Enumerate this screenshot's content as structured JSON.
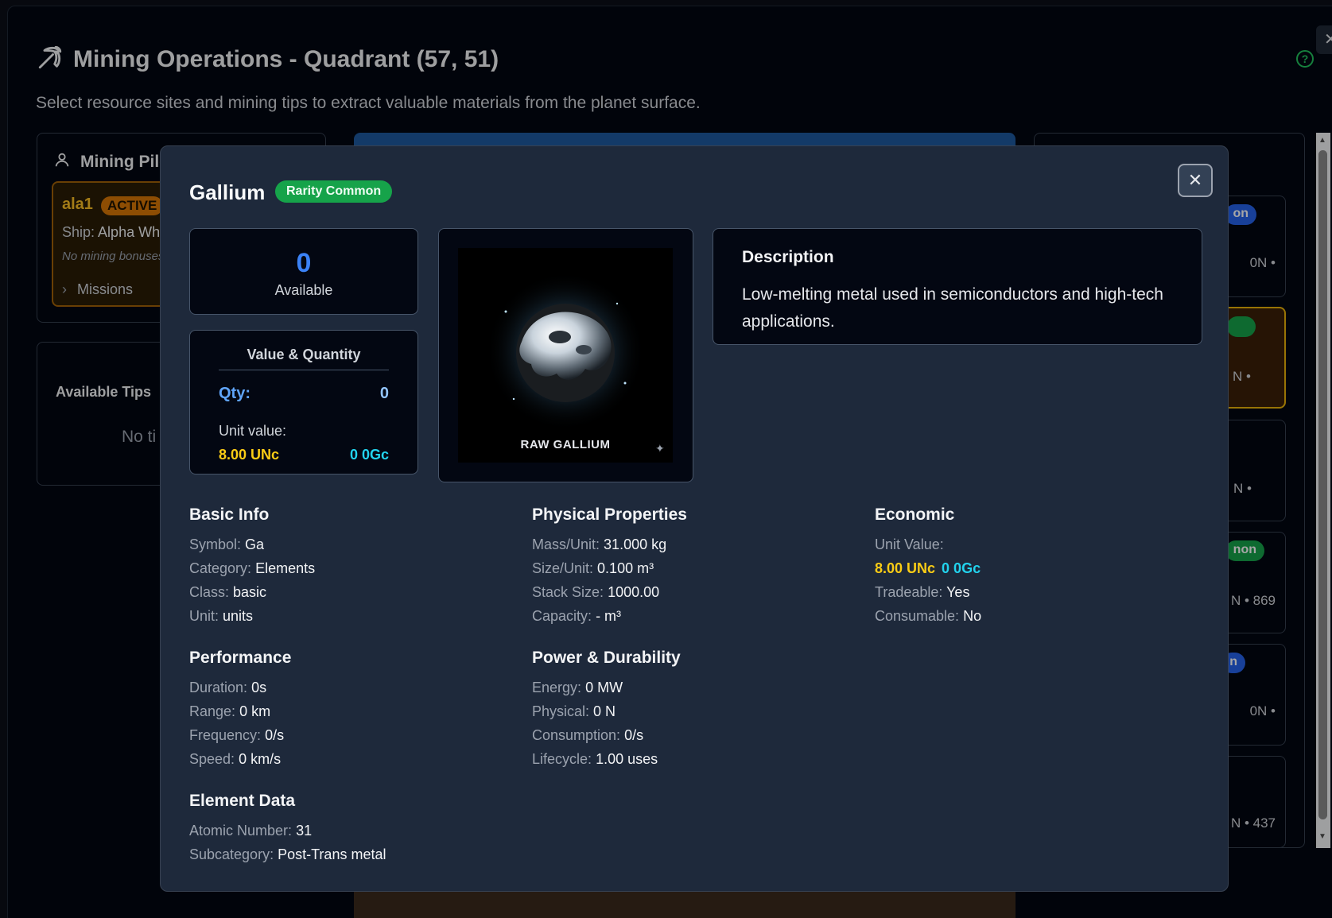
{
  "page": {
    "title": "Mining Operations - Quadrant (57, 51)",
    "subtitle": "Select resource sites and mining tips to extract valuable materials from the planet surface."
  },
  "pilot": {
    "heading": "Mining Pilo",
    "name": "ala1",
    "status": "ACTIVE",
    "ship_label": "Ship:",
    "ship_value": "Alpha Wh",
    "bonus_text": "No mining bonuses",
    "missions_label": "Missions"
  },
  "tips": {
    "label": "Available Tips",
    "empty": "No ti"
  },
  "sites": [
    {
      "badge": "on",
      "badge_color": "#2563eb",
      "meta": "0N •"
    },
    {
      "badge": "",
      "badge_color": "#16a34a",
      "meta": "N •"
    },
    {
      "badge": "",
      "badge_color": "",
      "meta": "N •"
    },
    {
      "badge": "non",
      "badge_color": "#16a34a",
      "meta": "N • 869"
    },
    {
      "badge": "n",
      "badge_color": "#2563eb",
      "meta": "0N •"
    },
    {
      "badge": "",
      "badge_color": "",
      "meta": "N • 437"
    }
  ],
  "modal": {
    "title": "Gallium",
    "rarity": "Rarity Common",
    "close": "✕",
    "available_value": "0",
    "available_label": "Available",
    "value_quantity_title": "Value & Quantity",
    "qty_label": "Qty:",
    "qty_value": "0",
    "unit_value_label": "Unit value:",
    "unit_value_unc": "8.00 UNc",
    "unit_value_gc": "0 0Gc",
    "image_caption": "RAW GALLIUM",
    "description_title": "Description",
    "description_text": "Low-melting metal used in semiconductors and high-tech applications.",
    "basic_info": {
      "title": "Basic Info",
      "rows": [
        {
          "label": "Symbol:",
          "value": "Ga"
        },
        {
          "label": "Category:",
          "value": "Elements"
        },
        {
          "label": "Class:",
          "value": "basic"
        },
        {
          "label": "Unit:",
          "value": "units"
        }
      ]
    },
    "physical": {
      "title": "Physical Properties",
      "rows": [
        {
          "label": "Mass/Unit:",
          "value": "31.000 kg"
        },
        {
          "label": "Size/Unit:",
          "value": "0.100 m³"
        },
        {
          "label": "Stack Size:",
          "value": "1000.00"
        },
        {
          "label": "Capacity:",
          "value": "- m³"
        }
      ]
    },
    "economic": {
      "title": "Economic",
      "unit_value_label": "Unit Value:",
      "unit_value_unc": "8.00 UNc",
      "unit_value_gc": "0 0Gc",
      "tradeable_label": "Tradeable:",
      "tradeable_value": "Yes",
      "consumable_label": "Consumable:",
      "consumable_value": "No"
    },
    "performance": {
      "title": "Performance",
      "rows": [
        {
          "label": "Duration:",
          "value": "0s"
        },
        {
          "label": "Range:",
          "value": "0 km"
        },
        {
          "label": "Frequency:",
          "value": "0/s"
        },
        {
          "label": "Speed:",
          "value": "0 km/s"
        }
      ]
    },
    "power": {
      "title": "Power & Durability",
      "rows": [
        {
          "label": "Energy:",
          "value": "0 MW"
        },
        {
          "label": "Physical:",
          "value": "0 N"
        },
        {
          "label": "Consumption:",
          "value": "0/s"
        },
        {
          "label": "Lifecycle:",
          "value": "1.00 uses"
        }
      ]
    },
    "element": {
      "title": "Element Data",
      "rows": [
        {
          "label": "Atomic Number:",
          "value": "31"
        },
        {
          "label": "Subcategory:",
          "value": "Post-Trans metal"
        }
      ]
    }
  }
}
